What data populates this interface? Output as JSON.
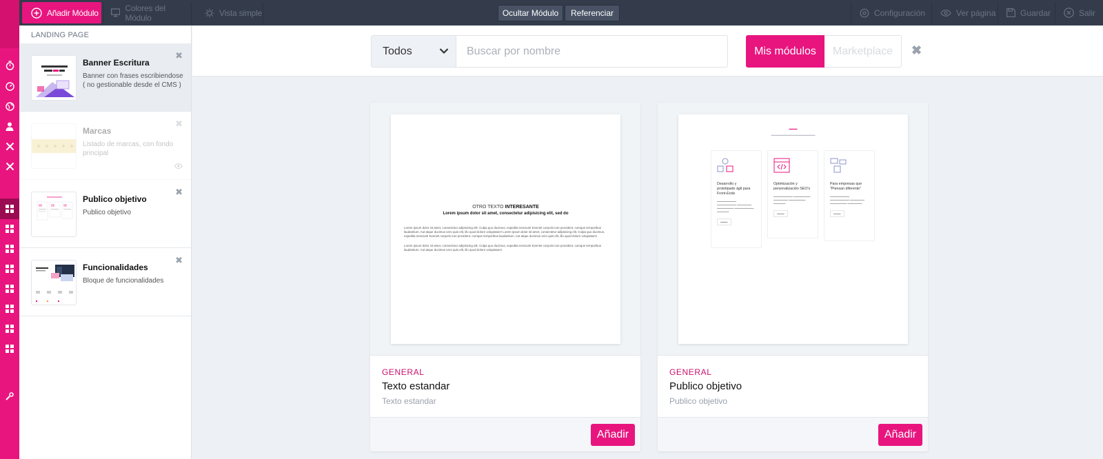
{
  "topbar": {
    "add_module": "Añadir Módulo",
    "module_colors": "Colores del Módulo",
    "simple_view": "Vista simple",
    "hide_module": "Ocultar Módulo",
    "reference": "Referenciar",
    "config": "Configuración",
    "view_page": "Ver página",
    "save": "Guardar",
    "exit": "Salir"
  },
  "sidebar": {
    "heading": "LANDING PAGE",
    "items": [
      {
        "title": "Banner Escritura",
        "desc": "Banner con frases escribiendose ( no gestionable desde el CMS )",
        "state": "active"
      },
      {
        "title": "Marcas",
        "desc": "Listado de marcas, con fondo principal",
        "state": "hidden"
      },
      {
        "title": "Publico objetivo",
        "desc": "Publico objetivo",
        "state": "normal"
      },
      {
        "title": "Funcionalidades",
        "desc": "Bloque de funcionalidades",
        "state": "normal"
      }
    ]
  },
  "search": {
    "category_selected": "Todos",
    "placeholder": "Buscar por nombre",
    "tab_mine": "Mis módulos",
    "tab_marketplace": "Marketplace"
  },
  "cards": [
    {
      "category": "GENERAL",
      "title": "Texto estandar",
      "subtitle": "Texto estandar",
      "add_label": "Añadir",
      "preview": {
        "kicker_a": "OTRO TEXTO ",
        "kicker_b": "INTERESANTE",
        "lead": "Lorem ipsum dolor sit amet, consectetur adipisicing elit, sed do",
        "body1": "Lorem ipsum dolor sit amet, consectetur adipisicing elit. Culpa quo ducimus, expedita nesciunt! Eveniet corporis iure provident, cumque temporibus laudantium. Aut atque ducimus vero quis elit, illo quod dolore voluptatum! Lorem ipsum dolor sit amet, consectetur adipisicing elit. Culpa quo ducimus, expedita nesciunt! Eveniet corporis iure provident, cumque temporibus laudantium. Aut atque ducimus vero quis elit, illo quod dolore voluptatum!",
        "body2": "Lorem ipsum dolor sit amet, consectetur adipisicing elit. Culpa quo ducimus, expedita nesciunt! Eveniet corporis iure provident, cumque temporibus laudantium. Aut atque ducimus vero quis elit, illo quod dolore voluptatum!"
      }
    },
    {
      "category": "GENERAL",
      "title": "Publico objetivo",
      "subtitle": "Publico objetivo",
      "add_label": "Añadir",
      "preview": {
        "columns": [
          {
            "title": "Desarrollo y prototipado ágil para Front-Ends"
          },
          {
            "title": "Optimización y personalización SEO's"
          },
          {
            "title": "Para empresas que \"Piensan diferente\""
          }
        ]
      }
    }
  ],
  "colors": {
    "accent": "#e8157f",
    "topbar": "#343c4b",
    "background": "#edf0f4"
  }
}
